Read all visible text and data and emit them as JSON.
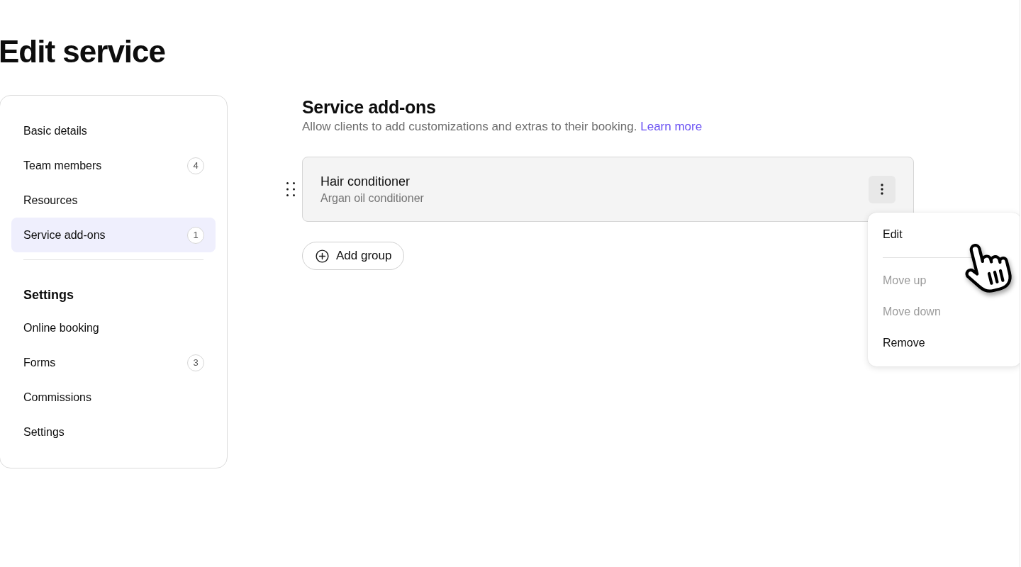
{
  "page_title": "Edit service",
  "sidebar": {
    "items": [
      {
        "label": "Basic details",
        "selected": false
      },
      {
        "label": "Team members",
        "badge": "4",
        "selected": false
      },
      {
        "label": "Resources",
        "selected": false
      },
      {
        "label": "Service add-ons",
        "badge": "1",
        "selected": true
      }
    ],
    "section_heading": "Settings",
    "section_items": [
      {
        "label": "Online booking",
        "selected": false
      },
      {
        "label": "Forms",
        "badge": "3",
        "selected": false
      },
      {
        "label": "Commissions",
        "selected": false
      },
      {
        "label": "Settings",
        "selected": false
      }
    ]
  },
  "addons_section": {
    "title": "Service add-ons",
    "description": "Allow clients to add customizations and extras to their booking.",
    "link": "Learn more",
    "addons": [
      {
        "name": "Hair conditioner",
        "description": "Argan oil conditioner"
      }
    ],
    "add_group_button": "Add group"
  },
  "context_menu": {
    "groups": [
      {
        "items": [
          {
            "label": "Edit",
            "disabled": false
          }
        ]
      },
      {
        "items": [
          {
            "label": "Move up",
            "disabled": true
          },
          {
            "label": "Move down",
            "disabled": true
          },
          {
            "label": "Remove",
            "disabled": false
          }
        ]
      }
    ]
  }
}
